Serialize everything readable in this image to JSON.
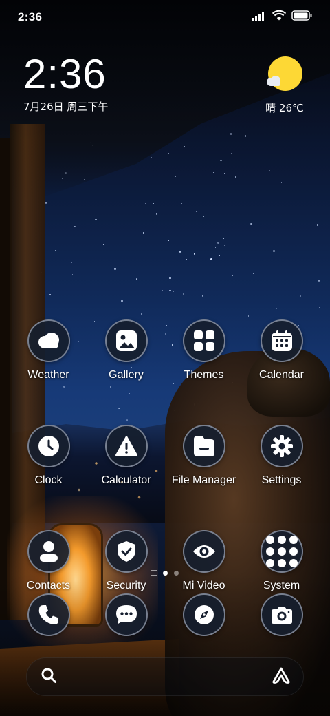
{
  "status_bar": {
    "time": "2:36",
    "icons": [
      "signal-icon",
      "wifi-icon",
      "battery-icon"
    ]
  },
  "clock_widget": {
    "time": "2:36",
    "date": "7月26日 周三下午"
  },
  "weather_widget": {
    "icon": "sunny-partly-cloudy-icon",
    "temperature": "晴 26℃"
  },
  "apps": [
    {
      "label": "Weather",
      "icon": "weather-cloud-icon"
    },
    {
      "label": "Gallery",
      "icon": "gallery-icon"
    },
    {
      "label": "Themes",
      "icon": "themes-grid-icon"
    },
    {
      "label": "Calendar",
      "icon": "calendar-icon"
    },
    {
      "label": "Clock",
      "icon": "clock-icon"
    },
    {
      "label": "Calculator",
      "icon": "warning-triangle-icon"
    },
    {
      "label": "File Manager",
      "icon": "folder-icon"
    },
    {
      "label": "Settings",
      "icon": "gear-icon"
    },
    {
      "label": "Contacts",
      "icon": "person-icon"
    },
    {
      "label": "Security",
      "icon": "shield-check-icon"
    },
    {
      "label": "Mi Video",
      "icon": "eye-icon"
    },
    {
      "label": "System",
      "icon": "folder-grid-icon"
    }
  ],
  "page_indicator": {
    "pages": 2,
    "active_page": 1
  },
  "dock": [
    {
      "icon": "phone-icon"
    },
    {
      "icon": "message-icon"
    },
    {
      "icon": "compass-icon"
    },
    {
      "icon": "camera-icon"
    }
  ],
  "search_bar": {
    "left_icon": "search-icon",
    "right_icon": "assistant-icon"
  },
  "colors": {
    "icon_background": "#161e2e",
    "icon_border": "#c8d2e1",
    "weather_sun": "#fdd835"
  }
}
